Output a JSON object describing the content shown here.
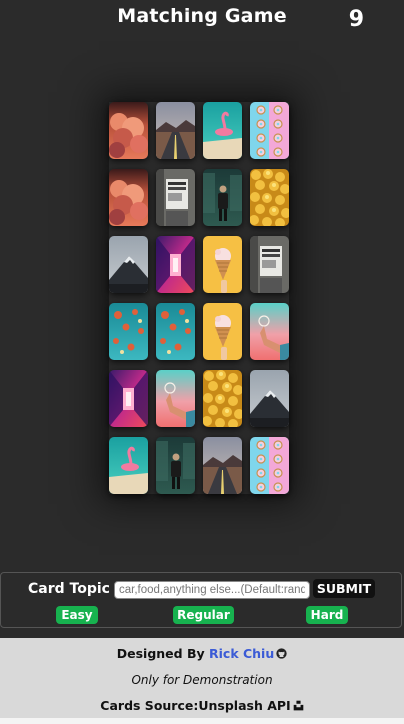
{
  "header": {
    "title": "Matching Game",
    "score": "9"
  },
  "board": {
    "columns": 4,
    "cards": [
      "clouds-sunset",
      "desert-road",
      "flamingo-float",
      "donuts",
      "clouds-sunset",
      "news-stand",
      "person-street",
      "popcorn",
      "mountain",
      "neon-corridor",
      "ice-cream",
      "news-stand",
      "hot-air-balloons",
      "hot-air-balloons",
      "ice-cream",
      "hand-sunset",
      "neon-corridor",
      "hand-sunset",
      "popcorn",
      "mountain",
      "flamingo-float",
      "person-street",
      "desert-road",
      "donuts"
    ]
  },
  "controls": {
    "topic_label": "Card Topic",
    "topic_placeholder": "car,food,anything else...(Default:random)",
    "submit_label": "SUBMIT",
    "easy_label": "Easy",
    "regular_label": "Regular",
    "hard_label": "Hard",
    "accent": "#17b24f"
  },
  "footer": {
    "designed_by": "Designed By",
    "author": "Rick Chiu",
    "note": "Only for Demonstration",
    "source": "Cards Source:Unsplash API",
    "author_color": "#3b5bd6"
  }
}
